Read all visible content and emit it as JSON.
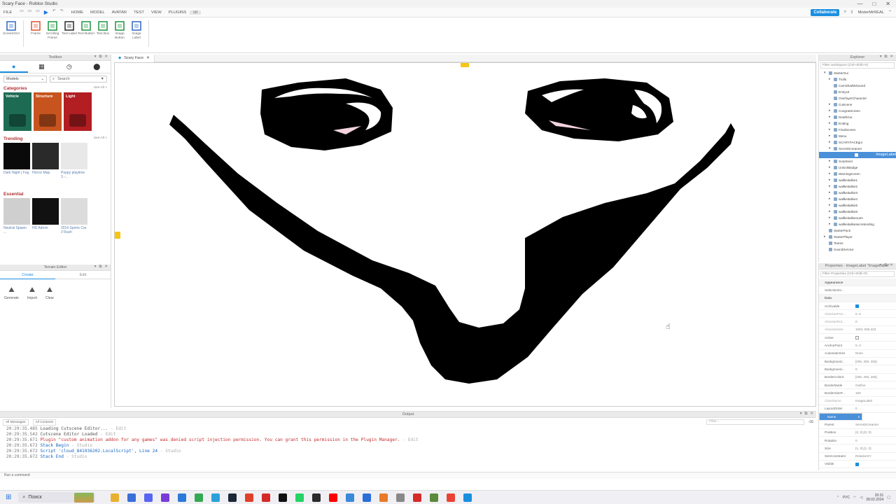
{
  "window": {
    "title": "Scary Face - Roblox Studio",
    "controls": [
      "—",
      "□",
      "✕"
    ]
  },
  "menu": {
    "file": "FILE",
    "tabs": [
      "HOME",
      "MODEL",
      "AVATAR",
      "TEST",
      "VIEW",
      "PLUGINS",
      "UI"
    ],
    "collaborate": "Collaborate",
    "user": "MisterMrREAL"
  },
  "ribbon": {
    "items": [
      {
        "label": "ScreenGUI",
        "icon": "screengui-icon",
        "color": "#3a6fc4"
      },
      {
        "label": "Frame",
        "icon": "frame-icon",
        "color": "#e05a3a"
      },
      {
        "label": "Scrolling Frame",
        "icon": "scrolling-frame-icon",
        "color": "#2a9a4a"
      },
      {
        "label": "Text Label",
        "icon": "text-label-icon",
        "color": "#333333"
      },
      {
        "label": "Text Button",
        "icon": "text-button-icon",
        "color": "#2a9a4a"
      },
      {
        "label": "Text Box",
        "icon": "text-box-icon",
        "color": "#2a9a4a"
      },
      {
        "label": "Image Button",
        "icon": "image-button-icon",
        "color": "#2a9a4a"
      },
      {
        "label": "Image Label",
        "icon": "image-label-icon",
        "color": "#3a6fc4"
      }
    ]
  },
  "toolbox": {
    "title": "Toolbox",
    "dropdown": "Models",
    "search_placeholder": "Search",
    "categories_title": "Categories",
    "see_all": "See All >",
    "categories": [
      {
        "label": "Vehicle",
        "color": "#1d6b52"
      },
      {
        "label": "Structure",
        "color": "#c7541e"
      },
      {
        "label": "Light",
        "color": "#b21e22"
      }
    ],
    "trending_title": "Trending",
    "trending": [
      "Dark Night | Fog",
      "Horror Map",
      "Poppy playtime 3 -..."
    ],
    "essential_title": "Essential",
    "essential": [
      "Neutral Spawn ...",
      "HD Admin",
      "2019 Sports Car // Rush"
    ]
  },
  "terrain": {
    "title": "Terrain Editor",
    "tabs": [
      "Create",
      "Edit"
    ],
    "tools": [
      "Generate",
      "Import",
      "Clear"
    ]
  },
  "document": {
    "tab": "Scary Face"
  },
  "explorer": {
    "title": "Explorer",
    "filter": "Filter workspace (Ctrl+Shift+X)",
    "rows": [
      {
        "label": "StarterGui",
        "depth": 1,
        "arrow": "▾",
        "selected": false
      },
      {
        "label": "Trolls",
        "depth": 2,
        "arrow": "▸",
        "selected": false
      },
      {
        "label": "CamShadWSound",
        "depth": 2,
        "arrow": "",
        "selected": false
      },
      {
        "label": "EntryUI",
        "depth": 2,
        "arrow": "",
        "selected": false
      },
      {
        "label": "OverlayerCharacter",
        "depth": 2,
        "arrow": "",
        "selected": false
      },
      {
        "label": "Cutscene",
        "depth": 2,
        "arrow": "▸",
        "selected": false
      },
      {
        "label": "CongratScreen",
        "depth": 2,
        "arrow": "▸",
        "selected": false
      },
      {
        "label": "DeathGui",
        "depth": 2,
        "arrow": "▸",
        "selected": false
      },
      {
        "label": "Ending",
        "depth": 2,
        "arrow": "▸",
        "selected": false
      },
      {
        "label": "FinalScreen",
        "depth": 2,
        "arrow": "▸",
        "selected": false
      },
      {
        "label": "Menu",
        "depth": 2,
        "arrow": "▸",
        "selected": false
      },
      {
        "label": "SCARYFACEgui",
        "depth": 2,
        "arrow": "▸",
        "selected": false
      },
      {
        "label": "SecretScreamer",
        "depth": 2,
        "arrow": "▾",
        "selected": false
      },
      {
        "label": "ImageLabel",
        "depth": 3,
        "arrow": "",
        "selected": true
      },
      {
        "label": "Surprised",
        "depth": 2,
        "arrow": "▸",
        "selected": false
      },
      {
        "label": "UnlockBadge",
        "depth": 2,
        "arrow": "▸",
        "selected": false
      },
      {
        "label": "Warningscreen",
        "depth": 2,
        "arrow": "▸",
        "selected": false
      },
      {
        "label": "wallkeitalkie1",
        "depth": 2,
        "arrow": "▸",
        "selected": false
      },
      {
        "label": "wallkeitalkie2",
        "depth": 2,
        "arrow": "▸",
        "selected": false
      },
      {
        "label": "wallkeitalkie3",
        "depth": 2,
        "arrow": "▸",
        "selected": false
      },
      {
        "label": "wallkeitalkie4",
        "depth": 2,
        "arrow": "▸",
        "selected": false
      },
      {
        "label": "wallkeitalkie5",
        "depth": 2,
        "arrow": "▸",
        "selected": false
      },
      {
        "label": "wallkeitalkie6",
        "depth": 2,
        "arrow": "▸",
        "selected": false
      },
      {
        "label": "wallkeitalkieoutro",
        "depth": 2,
        "arrow": "▸",
        "selected": false
      },
      {
        "label": "wallkeitalkiesecretending",
        "depth": 2,
        "arrow": "▸",
        "selected": false
      },
      {
        "label": "StarterPack",
        "depth": 1,
        "arrow": "",
        "selected": false
      },
      {
        "label": "StarterPlayer",
        "depth": 1,
        "arrow": "▸",
        "selected": false
      },
      {
        "label": "Teams",
        "depth": 1,
        "arrow": "",
        "selected": false
      },
      {
        "label": "SoundService",
        "depth": 1,
        "arrow": "",
        "selected": false
      }
    ]
  },
  "properties": {
    "title": "Properties - ImageLabel \"ImageLabel\"",
    "filter": "Filter Properties (Ctrl+Shift+P)",
    "rows": [
      {
        "k": "Appearance",
        "v": "",
        "type": "group"
      },
      {
        "k": "SelectionIm...",
        "v": "",
        "type": "row"
      },
      {
        "k": "Data",
        "v": "",
        "type": "group"
      },
      {
        "k": "Archivable",
        "v": "",
        "type": "check"
      },
      {
        "k": "AbsolutePos...",
        "v": "0, 0",
        "type": "dim"
      },
      {
        "k": "AbsoluteRot...",
        "v": "0",
        "type": "dim"
      },
      {
        "k": "AbsoluteSize",
        "v": "1004, 565.333",
        "type": "dim"
      },
      {
        "k": "Active",
        "v": "",
        "type": "uncheck"
      },
      {
        "k": "AnchorPoint",
        "v": "0, 0",
        "type": "row"
      },
      {
        "k": "AutomaticSize",
        "v": "None",
        "type": "row"
      },
      {
        "k": "Background...",
        "v": "[255, 255, 255]",
        "type": "row"
      },
      {
        "k": "Background...",
        "v": "0",
        "type": "row"
      },
      {
        "k": "BorderColor3",
        "v": "[255, 255, 255]",
        "type": "row"
      },
      {
        "k": "BorderMode",
        "v": "Outline",
        "type": "row"
      },
      {
        "k": "BorderSizeP...",
        "v": "100",
        "type": "row"
      },
      {
        "k": "ClassName",
        "v": "ImageLabel",
        "type": "dim"
      },
      {
        "k": "LayoutOrder",
        "v": "0",
        "type": "row"
      },
      {
        "k": "Name",
        "v": "ImageLabel",
        "type": "selected"
      },
      {
        "k": "Parent",
        "v": "SecretScreamer",
        "type": "row"
      },
      {
        "k": "Position",
        "v": "{0, 0},{0, 0}",
        "type": "row"
      },
      {
        "k": "Rotation",
        "v": "0",
        "type": "row"
      },
      {
        "k": "Size",
        "v": "{1, 0},{1, 0}",
        "type": "row"
      },
      {
        "k": "SizeConstraint",
        "v": "RelativeXY",
        "type": "row"
      },
      {
        "k": "Visible",
        "v": "",
        "type": "check"
      }
    ]
  },
  "output": {
    "title": "Output",
    "messages_dropdown": "All Messages",
    "contexts_dropdown": "All Contexts",
    "filter_placeholder": "Filter...",
    "lines": [
      {
        "ts": "20:29:35.485",
        "text": "Loading Cutscene Editor...",
        "src": "  -  Edit",
        "kind": "info"
      },
      {
        "ts": "20:29:35.542",
        "text": "Cutscene Editor Loaded",
        "src": "  -  Edit",
        "kind": "info"
      },
      {
        "ts": "20:29:35.671",
        "text": "Plugin \"custom animation addon for any games\" was denied script injection permission. You can grant this permission in the Plugin Manager.",
        "src": "  -  Edit",
        "kind": "err"
      },
      {
        "ts": "20:29:35.672",
        "text": "Stack Begin",
        "src": "  -  Studio",
        "kind": "blue"
      },
      {
        "ts": "20:29:35.672",
        "text": "Script 'cloud_841936202.LocalScript', Line 24",
        "src": "  -  Studio",
        "kind": "blue"
      },
      {
        "ts": "20:29:35.672",
        "text": "Stack End",
        "src": "  -  Studio",
        "kind": "blue"
      }
    ]
  },
  "command_bar": {
    "placeholder": "Run a command"
  },
  "taskbar": {
    "search": "Поиск",
    "lang": "РУС",
    "time": "20:31",
    "date": "28.02.2024",
    "apps": [
      {
        "icon": "file-explorer-icon",
        "color": "#e8b030"
      },
      {
        "icon": "store-icon",
        "color": "#3a6fd8"
      },
      {
        "icon": "discord-icon",
        "color": "#5865f2"
      },
      {
        "icon": "media-icon",
        "color": "#7a3ad8"
      },
      {
        "icon": "calendar-icon",
        "color": "#2a7ad8"
      },
      {
        "icon": "chrome-icon",
        "color": "#34a853"
      },
      {
        "icon": "telegram-icon",
        "color": "#2aa1da"
      },
      {
        "icon": "steam-icon",
        "color": "#1b2838"
      },
      {
        "icon": "autocad-icon",
        "color": "#e0402a"
      },
      {
        "icon": "zoom-icon",
        "color": "#d42a2a"
      },
      {
        "icon": "tiktok-icon",
        "color": "#111111"
      },
      {
        "icon": "whatsapp-icon",
        "color": "#25d366"
      },
      {
        "icon": "terminal-icon",
        "color": "#2b2b2b"
      },
      {
        "icon": "youtube-icon",
        "color": "#ff0000"
      },
      {
        "icon": "snip-icon",
        "color": "#3a8ad8"
      },
      {
        "icon": "vscode-icon",
        "color": "#2a6fd8"
      },
      {
        "icon": "paint-icon",
        "color": "#e87a2a"
      },
      {
        "icon": "mouse-icon",
        "color": "#888888"
      },
      {
        "icon": "recorder-icon",
        "color": "#d42a2a"
      },
      {
        "icon": "minecraft-icon",
        "color": "#5a8a3a"
      },
      {
        "icon": "chrome-alt-icon",
        "color": "#ea4335"
      },
      {
        "icon": "roblox-studio-icon",
        "color": "#1a8fe0"
      }
    ]
  }
}
